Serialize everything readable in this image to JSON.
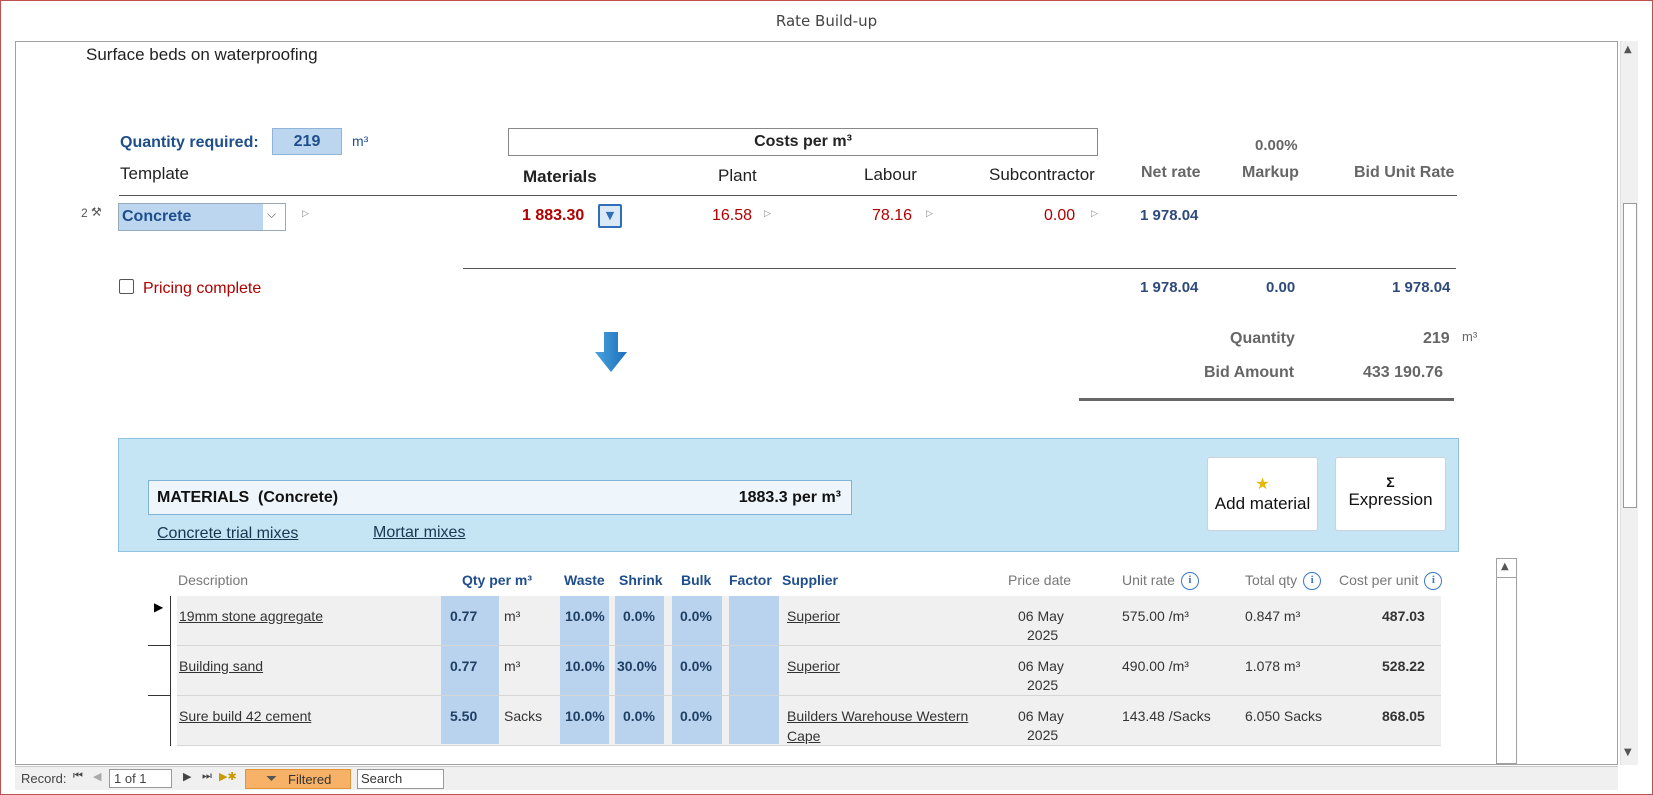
{
  "window": {
    "title": "Rate Build-up"
  },
  "item": {
    "description": "Surface beds on waterproofing"
  },
  "quantity": {
    "label": "Quantity required:",
    "value": "219",
    "unit": "m³"
  },
  "template_label": "Template",
  "costs_header": "Costs per m³",
  "columns": {
    "materials": "Materials",
    "plant": "Plant",
    "labour": "Labour",
    "subcontractor": "Subcontractor",
    "net_rate": "Net rate",
    "markup": "Markup",
    "markup_pct": "0.00%",
    "bid_unit_rate": "Bid Unit Rate"
  },
  "rate_row": {
    "index": "2",
    "template": "Concrete",
    "materials": "1 883.30",
    "plant": "16.58",
    "labour": "78.16",
    "subcontractor": "0.00",
    "net_rate": "1 978.04"
  },
  "pricing_complete": {
    "label": "Pricing complete",
    "checked": false
  },
  "totals": {
    "net_rate": "1 978.04",
    "markup": "0.00",
    "bid_unit_rate": "1 978.04"
  },
  "summary": {
    "quantity_label": "Quantity",
    "quantity_value": "219",
    "quantity_unit": "m³",
    "bid_amount_label": "Bid Amount",
    "bid_amount_value": "433 190.76"
  },
  "materials_panel": {
    "title": "MATERIALS  (Concrete)",
    "total": "1883.3 per m³",
    "links": [
      "Concrete trial mixes",
      "Mortar mixes"
    ],
    "add_button": "Add material",
    "expression_symbol": "Σ",
    "expression_button": "Expression"
  },
  "grid": {
    "headers": {
      "description": "Description",
      "qty": "Qty per m³",
      "waste": "Waste",
      "shrink": "Shrink",
      "bulk": "Bulk",
      "factor": "Factor",
      "supplier": "Supplier",
      "price_date": "Price date",
      "unit_rate": "Unit rate",
      "total_qty": "Total qty",
      "cost_per_unit": "Cost per unit"
    },
    "rows": [
      {
        "description": "19mm stone aggregate",
        "qty": "0.77",
        "unit": "m³",
        "waste": "10.0%",
        "shrink": "0.0%",
        "bulk": "0.0%",
        "supplier": "Superior",
        "supplier2": "",
        "date1": "06 May",
        "date2": "2025",
        "unit_rate": "575.00 /m³",
        "total_qty": "0.847 m³",
        "cost": "487.03"
      },
      {
        "description": "Building sand",
        "qty": "0.77",
        "unit": "m³",
        "waste": "10.0%",
        "shrink": "30.0%",
        "bulk": "0.0%",
        "supplier": "Superior",
        "supplier2": "",
        "date1": "06 May",
        "date2": "2025",
        "unit_rate": "490.00 /m³",
        "total_qty": "1.078 m³",
        "cost": "528.22"
      },
      {
        "description": "Sure build 42 cement",
        "qty": "5.50",
        "unit": "Sacks",
        "waste": "10.0%",
        "shrink": "0.0%",
        "bulk": "0.0%",
        "supplier": "Builders Warehouse Western",
        "supplier2": "Cape",
        "date1": "06 May",
        "date2": "2025",
        "unit_rate": "143.48 /Sacks",
        "total_qty": "6.050 Sacks",
        "cost": "868.05"
      }
    ]
  },
  "statusbar": {
    "record_label": "Record:",
    "record_value": "1 of 1",
    "filter_label": "Filtered",
    "search_placeholder": "Search"
  },
  "colors": {
    "accent_red": "#b00000",
    "navy": "#2e4a7b",
    "panel_blue": "#c5e5f5",
    "filter_orange": "#f7b267"
  },
  "icons": [
    "tools-icon",
    "dropdown-arrow-icon",
    "expand-triangle-icon",
    "down-arrow-icon",
    "star-icon",
    "info-icon",
    "row-selector-icon"
  ]
}
